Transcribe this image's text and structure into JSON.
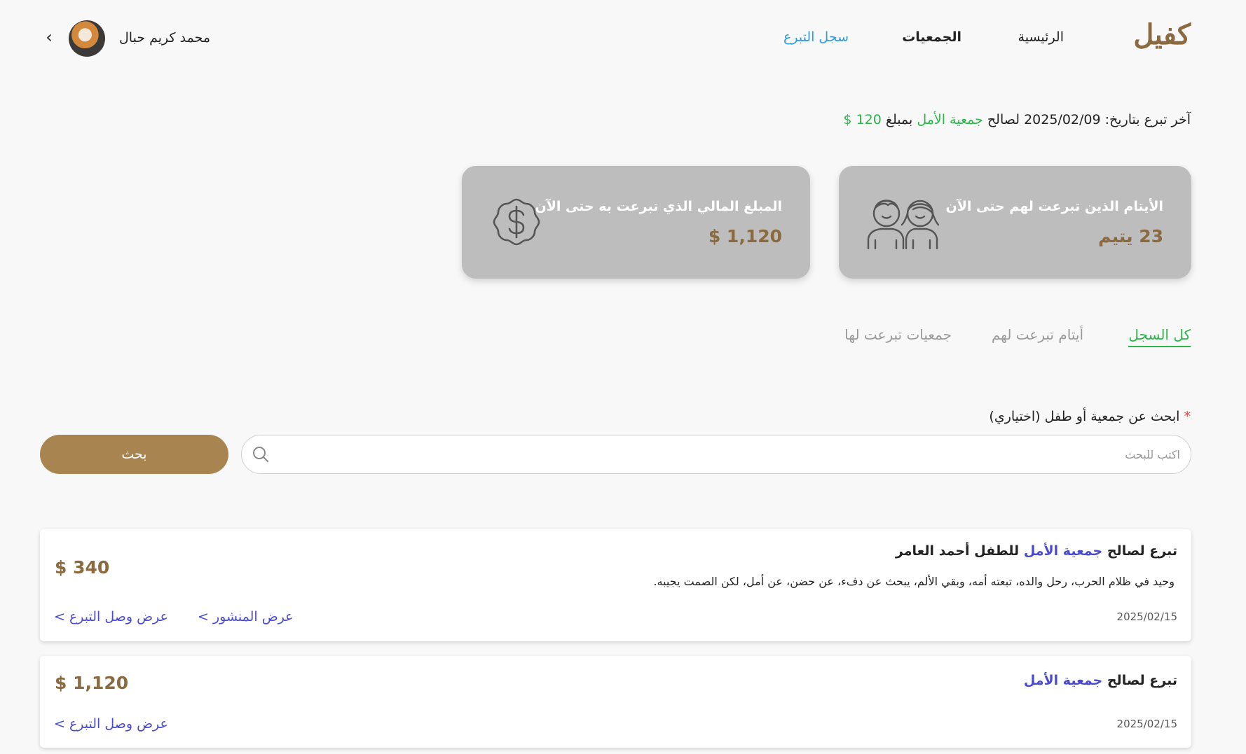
{
  "header": {
    "logo": "كفيل",
    "nav": {
      "home": "الرئيسية",
      "associations": "الجمعيات",
      "history": "سجل التبرع"
    },
    "user_name": "محمد كريم حبال",
    "back_icon": "‹"
  },
  "last_donation": {
    "prefix": "آخر تبرع بتاريخ: 2025/02/09 لصالح ",
    "association": "جمعية الأمل",
    "middle": " بمبلغ ",
    "amount": "120 $"
  },
  "stats": {
    "orphans_label": "الأيتام الذين تبرعت لهم حتى الآن",
    "orphans_value": "23 يتيم",
    "money_label": "المبلغ المالي الذي تبرعت به حتى الآن",
    "money_value": "1,120 $"
  },
  "tabs": {
    "all": "كل السجل",
    "orphans": "أيتام تبرعت لهم",
    "associations": "جمعيات تبرعت لها"
  },
  "search": {
    "label": "ابحث عن جمعية  أو طفل (اختياري)",
    "required_mark": "*",
    "placeholder": "اكتب للبحث",
    "button": "بحث"
  },
  "donations": [
    {
      "title_prefix": "تبرع لصالح ",
      "association": "جمعية الأمل",
      "title_suffix": " للطفل أحمد العامر",
      "description": "وحيد في ظلام الحرب، رحل والده، تبعته أمه، وبقي الألم، يبحث عن دفء، عن حضن، عن أمل، لكن الصمت يجيبه.",
      "date": "2025/02/15",
      "amount": "340 $",
      "view_post": "عرض المنشور >",
      "view_receipt": "عرض وصل التبرع >"
    },
    {
      "title_prefix": "تبرع لصالح ",
      "association": "جمعية الأمل",
      "date": "2025/02/15",
      "amount": "1,120 $",
      "view_receipt": "عرض وصل التبرع >"
    }
  ],
  "colors": {
    "brand": "#8a6a3e",
    "button": "#a88450",
    "accent_green": "#2db54b",
    "link_blue": "#4a4ad0",
    "nav_active": "#2f9be0",
    "card_gray": "#bdbdbd"
  }
}
